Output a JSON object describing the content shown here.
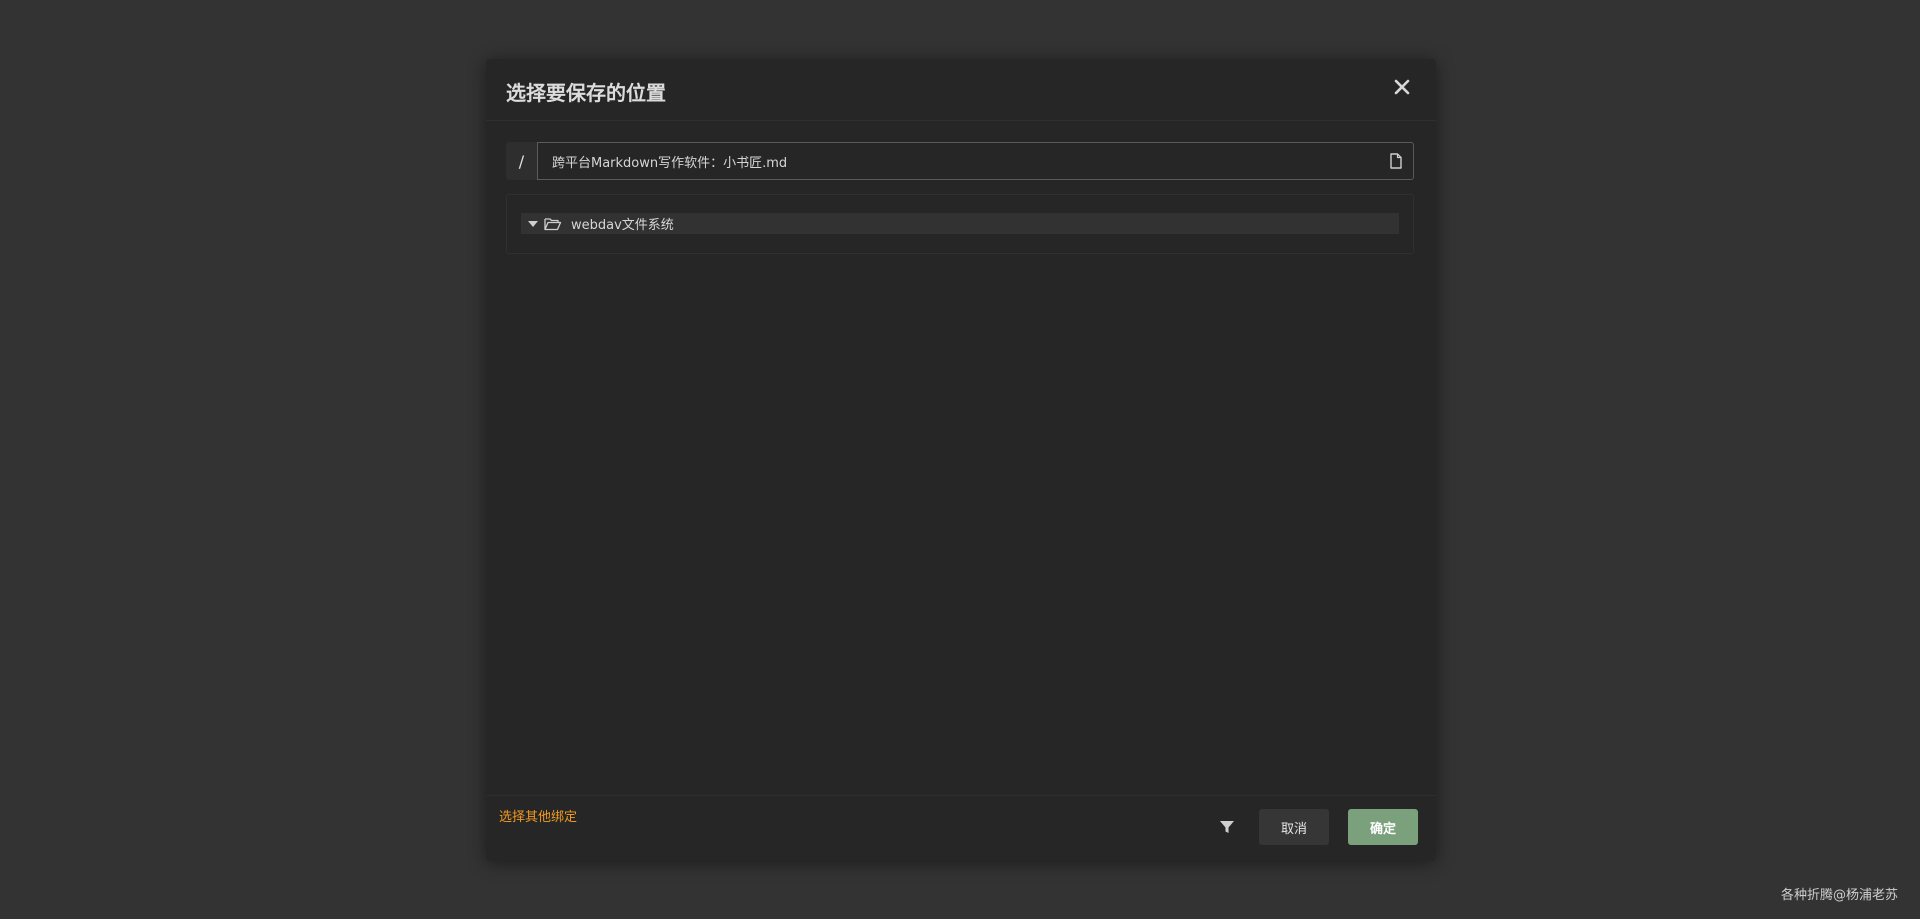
{
  "dialog": {
    "title": "选择要保存的位置",
    "close_icon": "close-icon"
  },
  "path": {
    "prefix": "/",
    "value": "跨平台Markdown写作软件：小书匠.md",
    "file_icon": "file-icon"
  },
  "tree": {
    "items": [
      {
        "label": "webdav文件系统",
        "expanded": true,
        "icon": "folder-open-icon"
      }
    ]
  },
  "footer": {
    "other_binding_label": "选择其他绑定",
    "filter_icon": "filter-icon",
    "cancel_label": "取消",
    "confirm_label": "确定"
  },
  "watermark": "各种折腾@杨浦老苏",
  "colors": {
    "background": "#333333",
    "dialog": "#262626",
    "accent_link": "#f09a1f",
    "confirm": "#7aa17c"
  }
}
